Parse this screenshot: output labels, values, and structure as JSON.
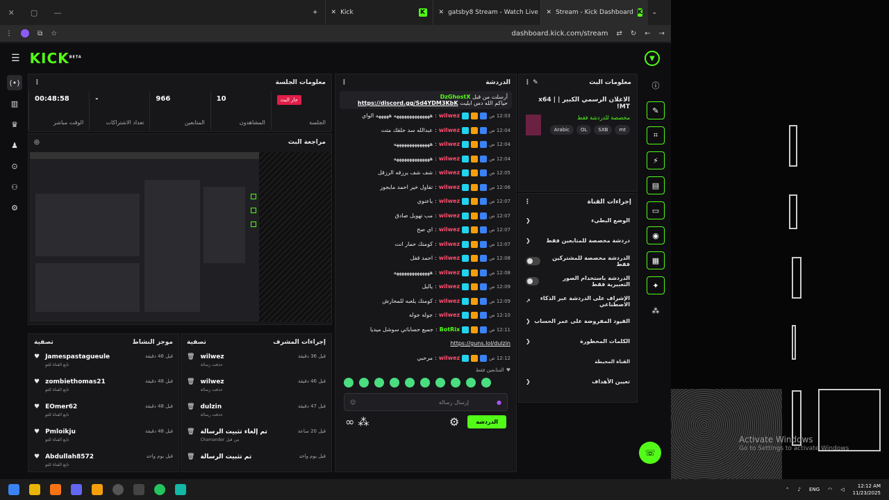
{
  "browser": {
    "tabs": [
      {
        "label": "Kick"
      },
      {
        "label": "gatsby8 Stream - Watch Live on"
      },
      {
        "label": "Stream - Kick Dashboard"
      }
    ],
    "url": "dashboard.kick.com/stream"
  },
  "kick": {
    "logo": "KICK",
    "beta": "BETA"
  },
  "session": {
    "title": "معلومات الجلسة",
    "live_badge": "جار البث",
    "session_label": "الجلسة",
    "stats": [
      {
        "value": "00:48:58",
        "label": "الوقت مباشر"
      },
      {
        "value": "-",
        "label": "تعداد الاشتراكات"
      },
      {
        "value": "966",
        "label": "المتابعين"
      },
      {
        "value": "10",
        "label": "المشاهدون"
      }
    ]
  },
  "preview": {
    "title": "مراجعة البث"
  },
  "activity": {
    "title": "موجز النشاط",
    "filter": "تصفية",
    "items": [
      {
        "name": "Jamespastagueule",
        "sub": "تابع القناة للتو",
        "time": "قبل 46 دقيقة"
      },
      {
        "name": "zombiethomas21",
        "sub": "تابع القناة للتو",
        "time": "قبل 48 دقيقة"
      },
      {
        "name": "EOmer62",
        "sub": "تابع القناة للتو",
        "time": "قبل 48 دقيقة"
      },
      {
        "name": "Pmloikju",
        "sub": "تابع القناة للتو",
        "time": "قبل 48 دقيقة"
      },
      {
        "name": "Abdullah8572",
        "sub": "تابع القناة للتو",
        "time": "قبل يوم واحد"
      }
    ]
  },
  "mod": {
    "title": "إجراءات المشرف",
    "filter": "تصفية",
    "items": [
      {
        "name": "wilwez",
        "sub": "حذفت رسالة",
        "time": "قبل 36 دقيقة"
      },
      {
        "name": "wilwez",
        "sub": "حذفت رسالة",
        "time": "قبل 46 دقيقة"
      },
      {
        "name": "dulzin",
        "sub": "حذفت رسالة",
        "time": "قبل 47 دقيقة"
      },
      {
        "name": "تم إلغاء تثبيت الرسالة",
        "sub": "Chamander من قبل",
        "time": "قبل 20 ساعة"
      },
      {
        "name": "تم تثبيت الرسالة",
        "sub": "",
        "time": "قبل يوم واحد"
      }
    ]
  },
  "chat": {
    "title": "الدردشة",
    "pinned_by": "أرسلت من قبل",
    "pinned_user": "DzGhostX",
    "pinned_text": "حياكم الله دس ايليت",
    "pinned_link": "https://discord.gg/Sd4YDM3KbK",
    "messages": [
      {
        "time": "12:03 ص",
        "user": "wilwez",
        "text": "ههههههههههههههه هههههه الواي"
      },
      {
        "time": "12:04 ص",
        "user": "wilwez",
        "text": "عبدالله سد حلقك متت"
      },
      {
        "time": "12:04 ص",
        "user": "wilwez",
        "text": "ههههههههههههههه"
      },
      {
        "time": "12:04 ص",
        "user": "wilwez",
        "text": "ههههههههههههههه"
      },
      {
        "time": "12:05 ص",
        "user": "wilwez",
        "text": "شف شف يرزقه الرزقل"
      },
      {
        "time": "12:06 ص",
        "user": "wilwez",
        "text": "تفاول خير احمد مايجوز"
      },
      {
        "time": "12:07 ص",
        "user": "wilwez",
        "text": "ياعنوي"
      },
      {
        "time": "12:07 ص",
        "user": "wilwez",
        "text": "مب تهويل صادق"
      },
      {
        "time": "12:07 ص",
        "user": "wilwez",
        "text": "اي صح"
      },
      {
        "time": "12:07 ص",
        "user": "wilwez",
        "text": "كومنك حمار انت"
      },
      {
        "time": "12:08 ص",
        "user": "wilwez",
        "text": "احمد قفل"
      },
      {
        "time": "12:08 ص",
        "user": "wilwez",
        "text": "ههههههههههههههه"
      },
      {
        "time": "12:09 ص",
        "user": "wilwez",
        "text": "ياليل"
      },
      {
        "time": "12:09 ص",
        "user": "wilwez",
        "text": "كومنك يلعبه للمحارش"
      },
      {
        "time": "12:10 ص",
        "user": "wilwez",
        "text": "جوله جوله"
      },
      {
        "time": "12:11 ص",
        "user": "BotRix",
        "text": "جميع حساباتي سوشل ميديا"
      },
      {
        "time": "12:12 ص",
        "user": "wilwez",
        "text": "مرحبي"
      }
    ],
    "botrix_link": "https://guns.lol/dulzin",
    "followers_only": "المتابعين فقط",
    "input_placeholder": "إرسال رسالة",
    "send_label": "الدردشة"
  },
  "stream_info": {
    "title": "معلومات البث",
    "stream_title": "الاعلان الرسمي الكبير | x64 | !MT",
    "category": "مخصصة للدردشة فقط",
    "tags": [
      "mt",
      "SXB",
      "OL",
      "Arabic"
    ]
  },
  "channel_actions": {
    "title": "إجراءات القناة",
    "rows": [
      {
        "label": "الوضع البطيء",
        "kind": "arrow"
      },
      {
        "label": "دردشة مخصصة للمتابعين فقط",
        "kind": "arrow"
      },
      {
        "label": "الدردشة مخصصة للمشتركين فقط",
        "kind": "toggle"
      },
      {
        "label": "الدردشة باستخدام الصور التعبيرية فقط",
        "kind": "toggle"
      },
      {
        "label": "الإشراف على الدردشة عبر الذكاء الاصطناعي",
        "kind": "ext"
      },
      {
        "label": "القيود المفروضة على عمر الحساب",
        "kind": "arrow"
      },
      {
        "label": "الكلمات المحظورة",
        "kind": "arrow"
      },
      {
        "label": "القناة المحيطة",
        "kind": "none"
      },
      {
        "label": "تعيين الأهداف",
        "kind": "arrow"
      }
    ]
  },
  "desktop": {
    "watermark1": "Activate Windows",
    "watermark2": "Go to Settings to activate Windows"
  },
  "taskbar": {
    "lang": "ENG",
    "time": "12:12 AM",
    "date": "11/23/2025"
  },
  "colors": {
    "accent": "#53fc18",
    "red": "#ff4d6d"
  }
}
